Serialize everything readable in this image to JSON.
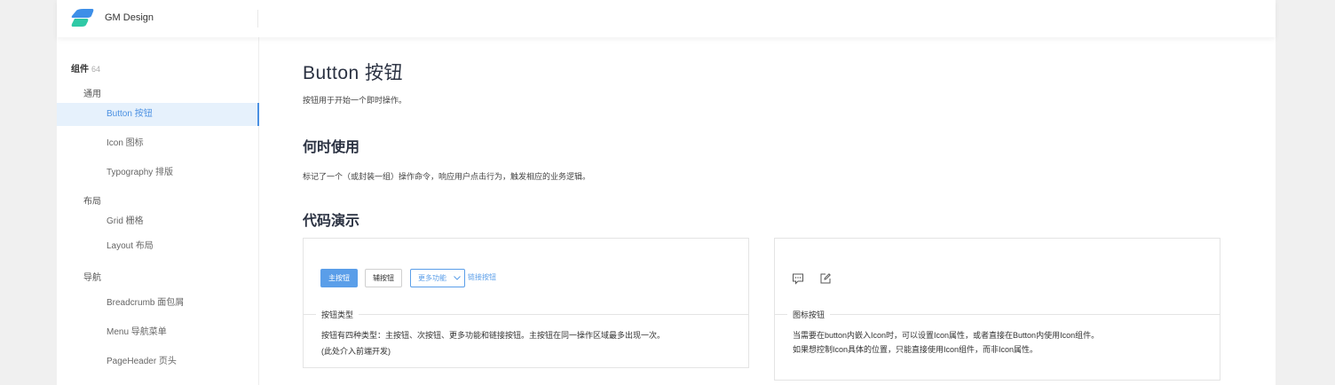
{
  "header": {
    "brand": "GM Design"
  },
  "sidebar": {
    "group": {
      "label": "组件",
      "count": "64"
    },
    "sections": [
      "通用",
      "布局",
      "导航"
    ],
    "items": [
      "Button 按钮",
      "Icon 图标",
      "Typography 排版",
      "Grid 栅格",
      "Layout 布局",
      "Breadcrumb 面包屑",
      "Menu 导航菜单",
      "PageHeader 页头"
    ],
    "active_item": "Button 按钮"
  },
  "main": {
    "title": "Button  按钮",
    "intro": "按钮用于开始一个即时操作。",
    "when_title": "何时使用",
    "when_desc": "标记了一个（或封装一组）操作命令，响应用户点击行为，触发相应的业务逻辑。",
    "demo_title": "代码演示"
  },
  "demo1": {
    "buttons": {
      "primary": "主按钮",
      "secondary": "辅按钮",
      "more": "更多功能",
      "link": "链接按钮"
    },
    "legend": "按钮类型",
    "note_line1": "按钮有四种类型：主按钮、次按钮、更多功能和链接按钮。主按钮在同一操作区域最多出现一次。",
    "note_line2": "(此处介入前端开发)"
  },
  "demo2": {
    "icons": [
      "message-icon",
      "edit-icon"
    ],
    "legend": "图标按钮",
    "note_line1": "当需要在button内嵌入Icon时，可以设置Icon属性，或者直接在Button内使用Icon组件。",
    "note_line2": "如果想控制Icon具体的位置，只能直接使用Icon组件，而非Icon属性。"
  },
  "colors": {
    "accent": "#5a9ee9",
    "active_bg": "#e6f1fc",
    "page_bg": "#f0f0f0"
  }
}
